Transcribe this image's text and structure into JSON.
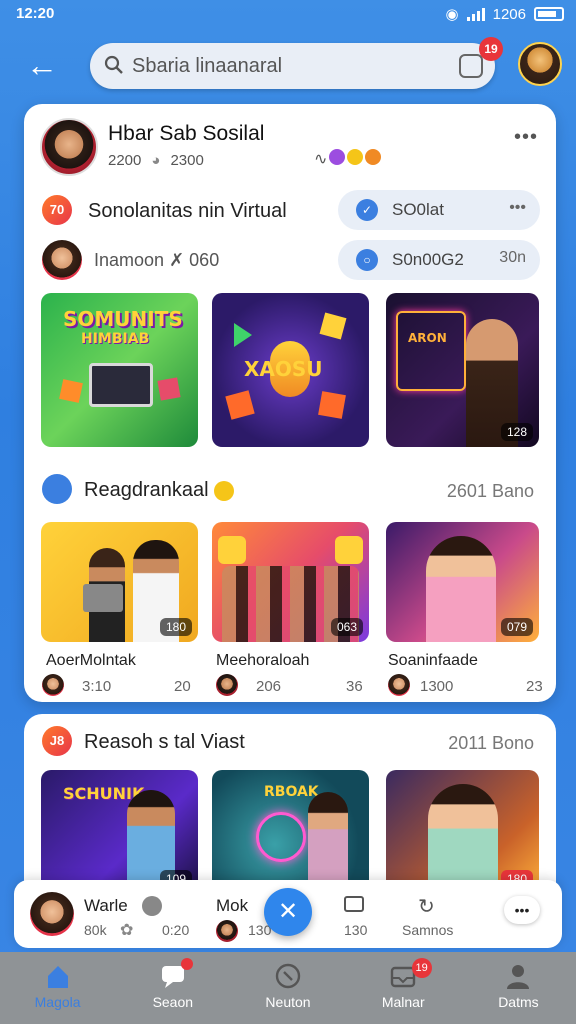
{
  "status_bar": {
    "time": "12:20",
    "right_text": "1206"
  },
  "header": {
    "search_text": "Sbaria linaanaral",
    "notification_count": "19"
  },
  "post": {
    "title": "Hbar Sab Sosilal",
    "meta_left": "2200",
    "meta_right": "2300",
    "reaction_text": "Co"
  },
  "row1": {
    "badge": "70",
    "label": "Sonolanitas nin Virtual",
    "pill_text": "SO0lat",
    "pill_more": "•••"
  },
  "row2": {
    "label": "Inamoon",
    "value": "060",
    "pill_text": "S0n00G2",
    "pill_more": "30n"
  },
  "tiles_top": [
    {
      "label": "SOMUNITS",
      "sublabel": "HIMBIAB",
      "count": ""
    },
    {
      "label": "XAOSU",
      "sublabel": "",
      "count": ""
    },
    {
      "label": "ARON",
      "sublabel": "",
      "count": "128"
    }
  ],
  "section1": {
    "title": "Reagdrankaal",
    "right": "2601 Bano",
    "items": [
      {
        "caption": "AoerMolntak",
        "sub_left": "3:10",
        "sub_right": "20",
        "count": "180"
      },
      {
        "caption": "Meehoraloah",
        "sub_left": "206",
        "sub_right": "36",
        "count": "063"
      },
      {
        "caption": "Soaninfaade",
        "sub_left": "1300",
        "sub_right": "23",
        "count": "079"
      }
    ]
  },
  "section2": {
    "badge": "J8",
    "title": "Reasoh s tal Viast",
    "right": "2011 Bono",
    "tiles": [
      {
        "label": "SCHUNIK",
        "count": "109"
      },
      {
        "label": "RBOAK",
        "count": ""
      },
      {
        "label": "",
        "count": "180"
      }
    ]
  },
  "post_strip": {
    "name1": "Warle",
    "sub1_left": "80k",
    "sub1_right": "0:20",
    "name2": "Mok",
    "sub2": "130",
    "icon_count": "130",
    "share_label": "Samnos",
    "more": "•••"
  },
  "nav": [
    {
      "label": "Magola",
      "active": true
    },
    {
      "label": "Seaon",
      "active": false,
      "badge": ""
    },
    {
      "label": "Neuton",
      "active": false
    },
    {
      "label": "Malnar",
      "active": false,
      "badge": "19"
    },
    {
      "label": "Datms",
      "active": false
    }
  ],
  "colors": {
    "accent": "#3b7fe0",
    "badge_red": "#e8353a",
    "nav_bg": "#8f9396"
  }
}
